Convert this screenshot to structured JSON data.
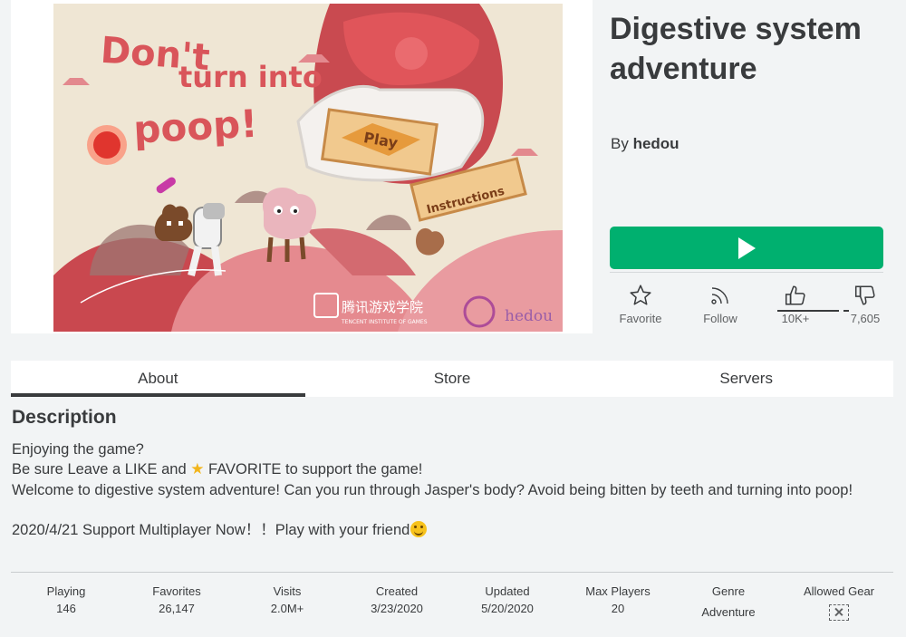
{
  "game": {
    "title": "Digestive system adventure",
    "by_label": "By",
    "creator": "hedou"
  },
  "thumbnail": {
    "headline_line1": "Don't",
    "headline_line2": "turn into",
    "headline_line3": "poop!",
    "play_sign": "Play",
    "instructions_sign": "Instructions",
    "brand_cn": "腾讯游戏学院",
    "brand_en": "TENCENT INSTITUTE OF GAMES",
    "brand_hedou": "hedou"
  },
  "play_button": {
    "icon": "play-icon",
    "color": "#00b06f"
  },
  "actions": {
    "favorite_label": "Favorite",
    "follow_label": "Follow",
    "upvotes": "10K+",
    "downvotes": "7,605"
  },
  "tabs": [
    {
      "label": "About",
      "active": true
    },
    {
      "label": "Store",
      "active": false
    },
    {
      "label": "Servers",
      "active": false
    }
  ],
  "description": {
    "heading": "Description",
    "line1": "Enjoying the game?",
    "line2_before": "Be sure  Leave a LIKE and ",
    "line2_after": " FAVORITE to support the game!",
    "line3": "Welcome to digestive system adventure! Can you run through Jasper's body?  Avoid being bitten by teeth and turning into poop!",
    "line4": "2020/4/21 Support Multiplayer Now！！Play with your friend"
  },
  "stats": [
    {
      "label": "Playing",
      "value": "146"
    },
    {
      "label": "Favorites",
      "value": "26,147"
    },
    {
      "label": "Visits",
      "value": "2.0M+"
    },
    {
      "label": "Created",
      "value": "3/23/2020"
    },
    {
      "label": "Updated",
      "value": "5/20/2020"
    },
    {
      "label": "Max Players",
      "value": "20"
    },
    {
      "label": "Genre",
      "value": "Adventure"
    },
    {
      "label": "Allowed Gear",
      "value": ""
    }
  ]
}
